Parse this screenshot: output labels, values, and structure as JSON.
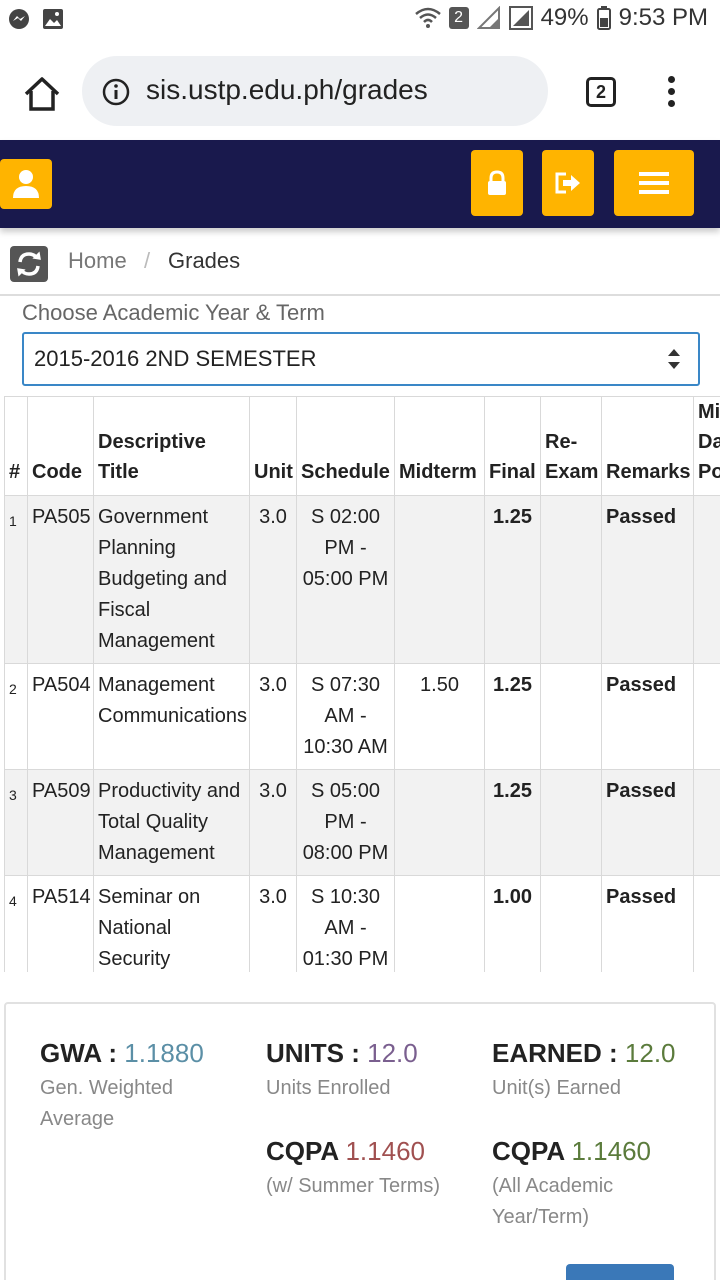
{
  "status_bar": {
    "wifi_badge": "2",
    "battery": "49%",
    "time": "9:53 PM"
  },
  "browser": {
    "url": "sis.ustp.edu.ph/grades",
    "tab_count": "2"
  },
  "header": {
    "accent_color": "#ffb400",
    "bar_color": "#19194d"
  },
  "breadcrumb": {
    "home": "Home",
    "separator": "/",
    "current": "Grades"
  },
  "term": {
    "label": "Choose Academic Year & Term",
    "selected": "2015-2016 2ND SEMESTER"
  },
  "table": {
    "headers": [
      "#",
      "Code",
      "Descriptive Title",
      "Unit",
      "Schedule",
      "Midterm",
      "Final",
      "Re-Exam",
      "Remarks",
      "Mid Da Po"
    ],
    "rows": [
      {
        "num": "1",
        "code": "PA505",
        "title": "Government Planning Budgeting and Fiscal Management",
        "unit": "3.0",
        "schedule": "S 02:00 PM - 05:00 PM",
        "midterm": "",
        "final": "1.25",
        "reexam": "",
        "remarks": "Passed"
      },
      {
        "num": "2",
        "code": "PA504",
        "title": "Management Communications",
        "unit": "3.0",
        "schedule": "S 07:30 AM - 10:30 AM",
        "midterm": "1.50",
        "final": "1.25",
        "reexam": "",
        "remarks": "Passed"
      },
      {
        "num": "3",
        "code": "PA509",
        "title": "Productivity and Total Quality Management",
        "unit": "3.0",
        "schedule": "S 05:00 PM - 08:00 PM",
        "midterm": "",
        "final": "1.25",
        "reexam": "",
        "remarks": "Passed"
      },
      {
        "num": "4",
        "code": "PA514",
        "title": "Seminar on National Security",
        "unit": "3.0",
        "schedule": "S 10:30 AM - 01:30 PM",
        "midterm": "",
        "final": "1.00",
        "reexam": "",
        "remarks": "Passed"
      }
    ]
  },
  "summary": {
    "gwa_label": "GWA :",
    "gwa_value": "1.1880",
    "gwa_sub": "Gen. Weighted Average",
    "units_label": "UNITS :",
    "units_value": "12.0",
    "units_sub": "Units Enrolled",
    "earned_label": "EARNED :",
    "earned_value": "12.0",
    "earned_sub": "Unit(s) Earned",
    "cqpa1_label": "CQPA",
    "cqpa1_value": "1.1460",
    "cqpa1_sub": "(w/ Summer Terms)",
    "cqpa2_label": "CQPA",
    "cqpa2_value": "1.1460",
    "cqpa2_sub": "(All Academic Year/Term)"
  }
}
